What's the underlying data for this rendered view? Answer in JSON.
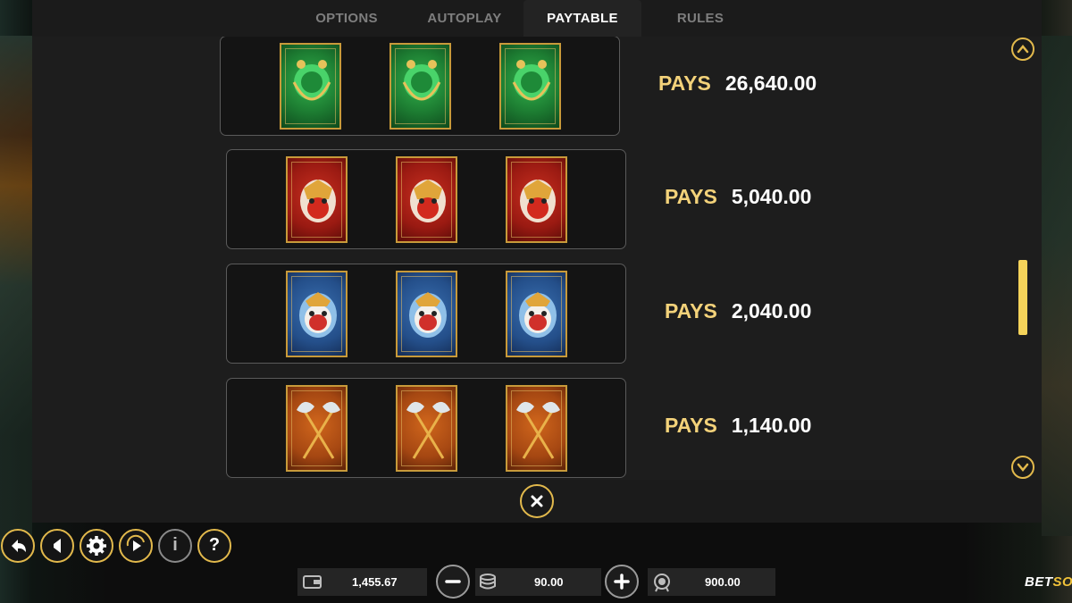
{
  "tabs": [
    {
      "label": "OPTIONS",
      "active": false
    },
    {
      "label": "AUTOPLAY",
      "active": false
    },
    {
      "label": "PAYTABLE",
      "active": true
    },
    {
      "label": "RULES",
      "active": false
    }
  ],
  "paytable": {
    "rows": [
      {
        "symbol_icon": "green-dragon-card-icon",
        "count": 3,
        "pays_label": "PAYS",
        "value": "26,640.00"
      },
      {
        "symbol_icon": "red-mask-card-icon",
        "count": 3,
        "pays_label": "PAYS",
        "value": "5,040.00"
      },
      {
        "symbol_icon": "blue-mask-card-icon",
        "count": 3,
        "pays_label": "PAYS",
        "value": "2,040.00"
      },
      {
        "symbol_icon": "crossed-axes-card-icon",
        "count": 3,
        "pays_label": "PAYS",
        "value": "1,140.00"
      }
    ],
    "scroll_position": 0.62
  },
  "controls": {
    "icons": [
      "back-icon",
      "sound-icon",
      "settings-gear-icon",
      "autoplay-icon",
      "info-icon",
      "help-icon"
    ],
    "info_label": "i",
    "help_label": "?"
  },
  "balance": {
    "icon": "wallet-icon",
    "value": "1,455.67"
  },
  "bet": {
    "icon": "coins-icon",
    "value": "90.00"
  },
  "win": {
    "icon": "medal-icon",
    "value": "900.00"
  },
  "brand": {
    "part1": "BET",
    "part2": "SOFT"
  },
  "colors": {
    "accent": "#e2b94c",
    "pays_label": "#f3d27a",
    "scroll_thumb": "#f5d35a"
  }
}
